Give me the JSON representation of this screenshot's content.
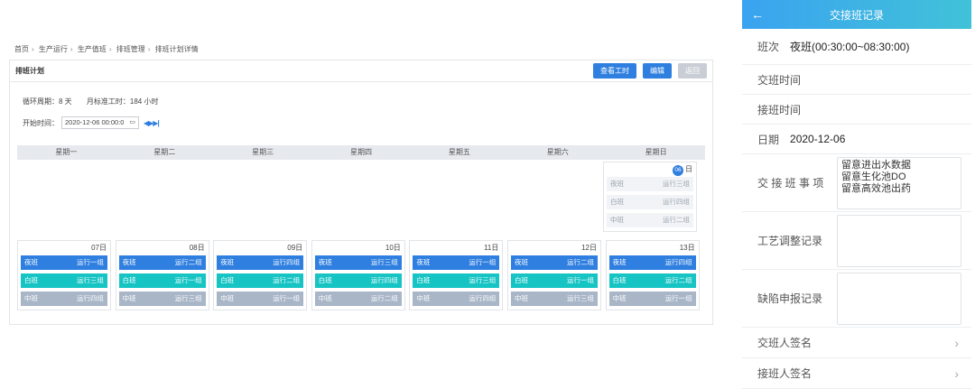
{
  "breadcrumb": [
    "首页",
    "生产运行",
    "生产值班",
    "排班管理",
    "排班计划详情"
  ],
  "card": {
    "title": "排班计划",
    "buttons": {
      "hours": "查看工时",
      "edit": "编辑",
      "back": "返回"
    },
    "cycle": "循环周期：8 天",
    "monthly_hours": "月标准工时：184 小时",
    "start_label": "开始时间：",
    "start_value": "2020-12-06 00:00:0"
  },
  "weekdays": [
    "星期一",
    "星期二",
    "星期三",
    "星期四",
    "星期五",
    "星期六",
    "星期日"
  ],
  "first_day": {
    "date": "06",
    "suffix": "日",
    "shifts": [
      {
        "label": "夜班",
        "team": "运行三组"
      },
      {
        "label": "白班",
        "team": "运行四组"
      },
      {
        "label": "中班",
        "team": "运行二组"
      }
    ]
  },
  "days": [
    {
      "date": "07日",
      "shifts": [
        {
          "label": "夜班",
          "team": "运行一组"
        },
        {
          "label": "白班",
          "team": "运行三组"
        },
        {
          "label": "中班",
          "team": "运行四组"
        }
      ]
    },
    {
      "date": "08日",
      "shifts": [
        {
          "label": "夜班",
          "team": "运行二组"
        },
        {
          "label": "白班",
          "team": "运行一组"
        },
        {
          "label": "中班",
          "team": "运行三组"
        }
      ]
    },
    {
      "date": "09日",
      "shifts": [
        {
          "label": "夜班",
          "team": "运行四组"
        },
        {
          "label": "白班",
          "team": "运行二组"
        },
        {
          "label": "中班",
          "team": "运行一组"
        }
      ]
    },
    {
      "date": "10日",
      "shifts": [
        {
          "label": "夜班",
          "team": "运行三组"
        },
        {
          "label": "白班",
          "team": "运行四组"
        },
        {
          "label": "中班",
          "team": "运行二组"
        }
      ]
    },
    {
      "date": "11日",
      "shifts": [
        {
          "label": "夜班",
          "team": "运行一组"
        },
        {
          "label": "白班",
          "team": "运行三组"
        },
        {
          "label": "中班",
          "team": "运行四组"
        }
      ]
    },
    {
      "date": "12日",
      "shifts": [
        {
          "label": "夜班",
          "team": "运行二组"
        },
        {
          "label": "白班",
          "team": "运行一组"
        },
        {
          "label": "中班",
          "team": "运行三组"
        }
      ]
    },
    {
      "date": "13日",
      "shifts": [
        {
          "label": "夜班",
          "team": "运行四组"
        },
        {
          "label": "白班",
          "team": "运行二组"
        },
        {
          "label": "中班",
          "team": "运行一组"
        }
      ]
    }
  ],
  "mobile": {
    "title": "交接班记录",
    "shift_label": "班次",
    "shift_value": "夜班(00:30:00~08:30:00)",
    "handover_time": "交班时间",
    "takeover_time": "接班时间",
    "date_label": "日期",
    "date_value": "2020-12-06",
    "matters_label": "交 接 班 事 项",
    "matters_lines": [
      "留意进出水数据",
      "留意生化池DO",
      "留意高效池出药"
    ],
    "process_label": "工艺调整记录",
    "defect_label": "缺陷申报记录",
    "handover_sign": "交班人签名",
    "takeover_sign": "接班人签名"
  },
  "colors": {
    "night": "#2f7fe0",
    "day": "#17c4c4",
    "mid": "#a8b6c8",
    "header": "#3aa3f0"
  }
}
